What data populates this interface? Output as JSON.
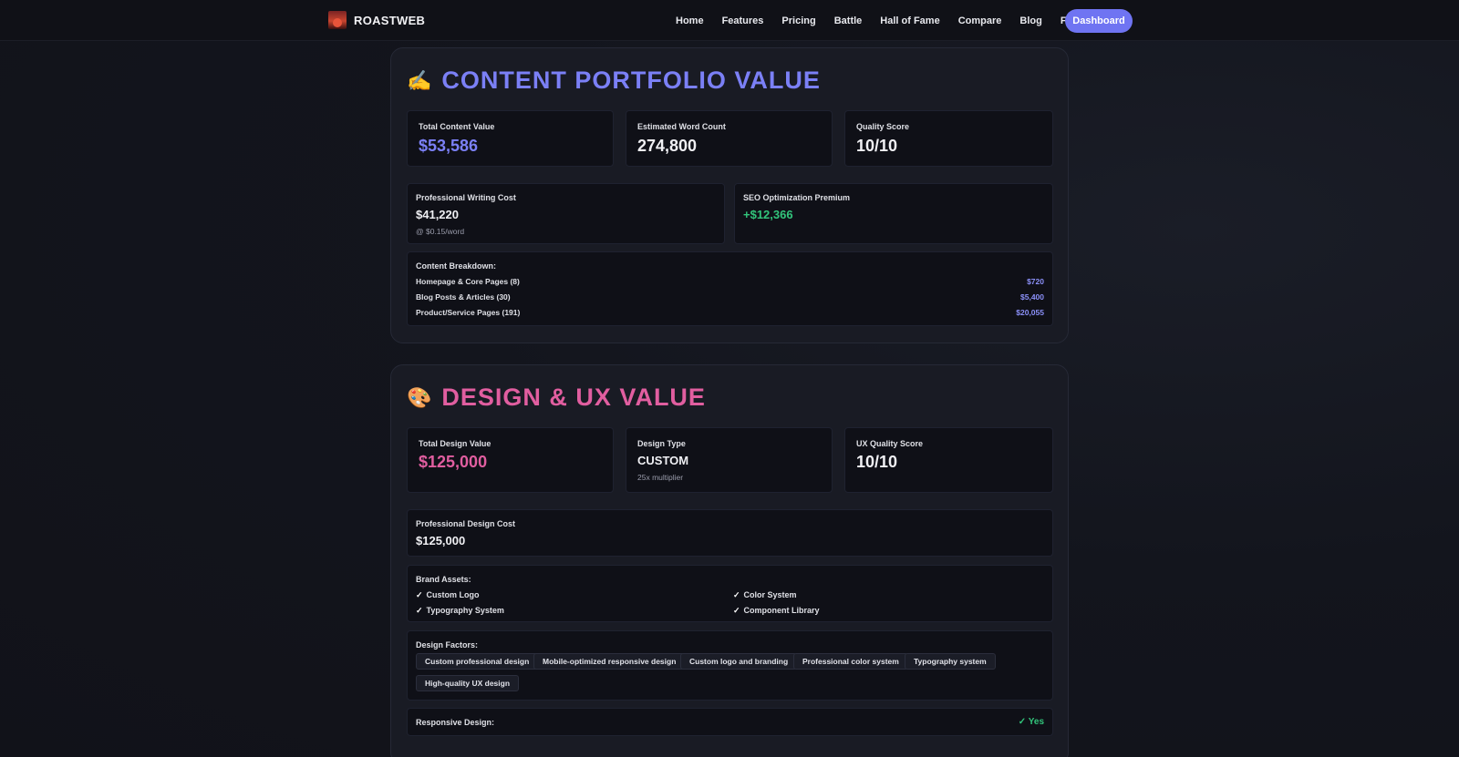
{
  "header": {
    "brand": "ROASTWEB",
    "nav": [
      "Home",
      "Features",
      "Pricing",
      "Battle",
      "Hall of Fame",
      "Compare",
      "Blog",
      "FAQ"
    ],
    "dashboard_label": "Dashboard"
  },
  "content": {
    "title": "CONTENT PORTFOLIO VALUE",
    "icon": "✍",
    "total_label": "Total Content Value",
    "total_value": "$53,586",
    "words_label": "Estimated Word Count",
    "words_value": "274,800",
    "quality_label": "Quality Score",
    "quality_value": "10/10",
    "writing_label": "Professional Writing Cost",
    "writing_value": "$41,220",
    "writing_note": "@ $0.15/word",
    "seo_label": "SEO Optimization Premium",
    "seo_value": "+$12,366",
    "breakdown_label": "Content Breakdown:",
    "breakdown": [
      {
        "label": "Homepage & Core Pages (8)",
        "value": "$720"
      },
      {
        "label": "Blog Posts & Articles (30)",
        "value": "$5,400"
      },
      {
        "label": "Product/Service Pages (191)",
        "value": "$20,055"
      }
    ]
  },
  "design": {
    "title": "DESIGN & UX VALUE",
    "icon": "🎨",
    "total_label": "Total Design Value",
    "total_value": "$125,000",
    "type_label": "Design Type",
    "type_value": "CUSTOM",
    "type_note": "25x multiplier",
    "ux_label": "UX Quality Score",
    "ux_value": "10/10",
    "cost_label": "Professional Design Cost",
    "cost_value": "$125,000",
    "assets_label": "Brand Assets:",
    "assets": [
      "Custom Logo",
      "Color System",
      "Typography System",
      "Component Library"
    ],
    "check_mark": "✓",
    "factors_label": "Design Factors:",
    "factors": [
      "Custom professional design",
      "Mobile-optimized responsive design",
      "Custom logo and branding",
      "Professional color system",
      "Typography system",
      "High-quality UX design"
    ],
    "responsive_label": "Responsive Design:",
    "responsive_value": "✓ Yes"
  },
  "colors": {
    "accent": "#6f74f2",
    "content_title": "#7b80f6",
    "design_title": "#e15ea0",
    "positive": "#32c47b"
  }
}
